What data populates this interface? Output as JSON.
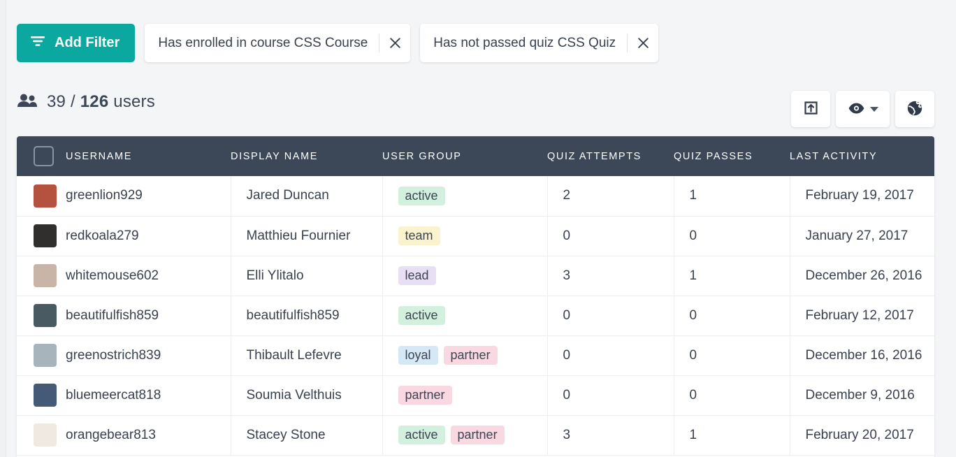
{
  "toolbar": {
    "add_filter_label": "Add Filter",
    "add_filter_icon": "filter-icon",
    "accent_color": "#0aa89e",
    "chips": [
      {
        "label": "Has enrolled in course CSS Course",
        "close_icon": "close-icon"
      },
      {
        "label": "Has not passed quiz CSS Quiz",
        "close_icon": "close-icon"
      }
    ]
  },
  "summary": {
    "users_icon": "users-icon",
    "shown": "39",
    "separator": "/",
    "total": "126",
    "unit": "users"
  },
  "actions": [
    {
      "name": "export-button",
      "icon": "export-icon"
    },
    {
      "name": "visibility-button",
      "icon": "eye-icon",
      "has_caret": true
    },
    {
      "name": "globe-button",
      "icon": "globe-icon"
    }
  ],
  "table": {
    "header_bg": "#3c4758",
    "select_all_checkbox": "checkbox",
    "columns": [
      "USERNAME",
      "DISPLAY NAME",
      "USER GROUP",
      "QUIZ ATTEMPTS",
      "QUIZ PASSES",
      "LAST ACTIVITY"
    ],
    "rows": [
      {
        "username": "greenlion929",
        "display_name": "Jared Duncan",
        "groups": [
          {
            "label": "active",
            "color": "#d3f0df"
          }
        ],
        "quiz_attempts": "2",
        "quiz_passes": "1",
        "last_activity": "February 19, 2017",
        "avatar_color": "#b4523f"
      },
      {
        "username": "redkoala279",
        "display_name": "Matthieu Fournier",
        "groups": [
          {
            "label": "team",
            "color": "#fbf2cf"
          }
        ],
        "quiz_attempts": "0",
        "quiz_passes": "0",
        "last_activity": "January 27, 2017",
        "avatar_color": "#312f2d"
      },
      {
        "username": "whitemouse602",
        "display_name": "Elli Ylitalo",
        "groups": [
          {
            "label": "lead",
            "color": "#e9dff5"
          }
        ],
        "quiz_attempts": "3",
        "quiz_passes": "1",
        "last_activity": "December 26, 2016",
        "avatar_color": "#c9b5a8"
      },
      {
        "username": "beautifulfish859",
        "display_name": "beautifulfish859",
        "groups": [
          {
            "label": "active",
            "color": "#d3f0df"
          }
        ],
        "quiz_attempts": "0",
        "quiz_passes": "0",
        "last_activity": "February 12, 2017",
        "avatar_color": "#4a5a63"
      },
      {
        "username": "greenostrich839",
        "display_name": "Thibault Lefevre",
        "groups": [
          {
            "label": "loyal",
            "color": "#d4e9f5"
          },
          {
            "label": "partner",
            "color": "#f9d8e2"
          }
        ],
        "quiz_attempts": "0",
        "quiz_passes": "0",
        "last_activity": "December 16, 2016",
        "avatar_color": "#a8b4bc"
      },
      {
        "username": "bluemeercat818",
        "display_name": "Soumia Velthuis",
        "groups": [
          {
            "label": "partner",
            "color": "#f9d8e2"
          }
        ],
        "quiz_attempts": "0",
        "quiz_passes": "0",
        "last_activity": "December 9, 2016",
        "avatar_color": "#455a77"
      },
      {
        "username": "orangebear813",
        "display_name": "Stacey Stone",
        "groups": [
          {
            "label": "active",
            "color": "#d3f0df"
          },
          {
            "label": "partner",
            "color": "#f9d8e2"
          }
        ],
        "quiz_attempts": "3",
        "quiz_passes": "1",
        "last_activity": "February 20, 2017",
        "avatar_color": "#efe9e2"
      }
    ]
  }
}
